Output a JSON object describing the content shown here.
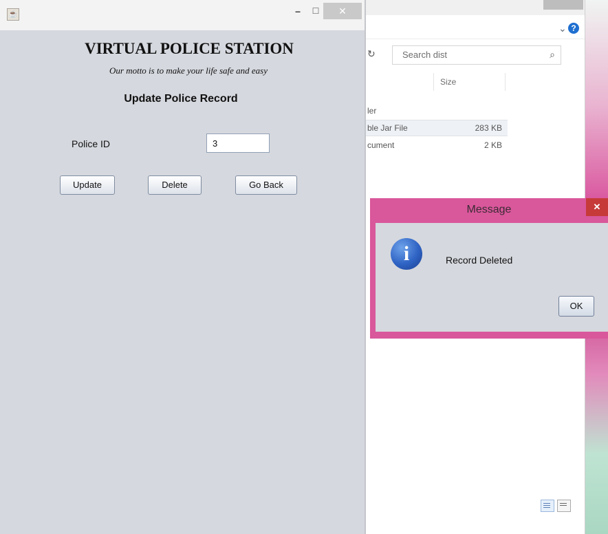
{
  "app": {
    "title": "VIRTUAL POLICE STATION",
    "motto": "Our motto is to make your life safe and easy",
    "heading": "Update Police Record",
    "field_label": "Police ID",
    "field_value": "3",
    "buttons": {
      "update": "Update",
      "delete": "Delete",
      "back": "Go Back"
    },
    "titlebar": {
      "minimize": "–",
      "maximize": "☐",
      "close": "✕"
    }
  },
  "explorer": {
    "search_placeholder": "Search dist",
    "column_size": "Size",
    "files": [
      {
        "name": "ler",
        "size": ""
      },
      {
        "name": "ble Jar File",
        "size": "283 KB"
      },
      {
        "name": "cument",
        "size": "2 KB"
      }
    ],
    "chevron": "⌄",
    "help": "?",
    "refresh": "↻",
    "search_icon": "⌕"
  },
  "dialog": {
    "title": "Message",
    "message": "Record Deleted",
    "ok": "OK",
    "close": "✕",
    "icon": "i"
  },
  "colors": {
    "dialog_frame": "#d9579b",
    "app_background": "#d5d8de"
  }
}
